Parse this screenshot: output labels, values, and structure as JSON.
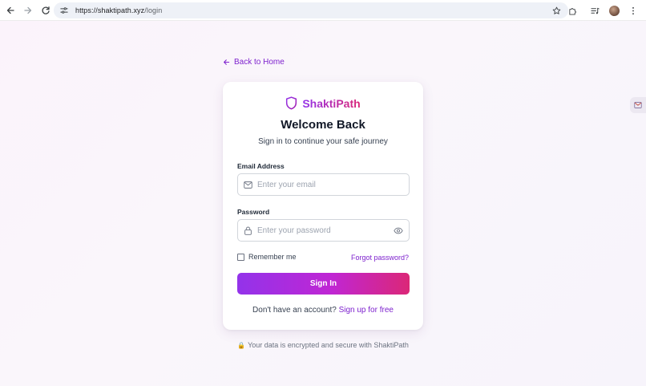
{
  "browser": {
    "url_host": "https://shaktipath.xyz",
    "url_path": "/login"
  },
  "page": {
    "back_link": "Back to Home",
    "brand_name": "ShaktiPath",
    "title": "Welcome Back",
    "subtitle": "Sign in to continue your safe journey",
    "email": {
      "label": "Email Address",
      "placeholder": "Enter your email",
      "value": ""
    },
    "password": {
      "label": "Password",
      "placeholder": "Enter your password",
      "value": ""
    },
    "remember_label": "Remember me",
    "remember_checked": false,
    "forgot_label": "Forgot password?",
    "signin_label": "Sign In",
    "signup_prompt": "Don't have an account?",
    "signup_link": "Sign up for free",
    "footer_text": "Your data is encrypted and secure with ShaktiPath"
  },
  "colors": {
    "accent_purple": "#7e22ce",
    "gradient_start": "#9333ea",
    "gradient_end": "#db2777"
  },
  "icons": {
    "back": "arrow-left-icon",
    "forward": "arrow-right-icon",
    "reload": "reload-icon",
    "site_settings": "tune-icon",
    "bookmark": "star-icon",
    "extensions": "puzzle-icon",
    "media": "media-control-icon",
    "menu": "kebab-menu-icon",
    "brand": "shield-icon",
    "email": "mail-icon",
    "password": "lock-icon",
    "show_password": "eye-icon",
    "footer": "lock-icon"
  }
}
